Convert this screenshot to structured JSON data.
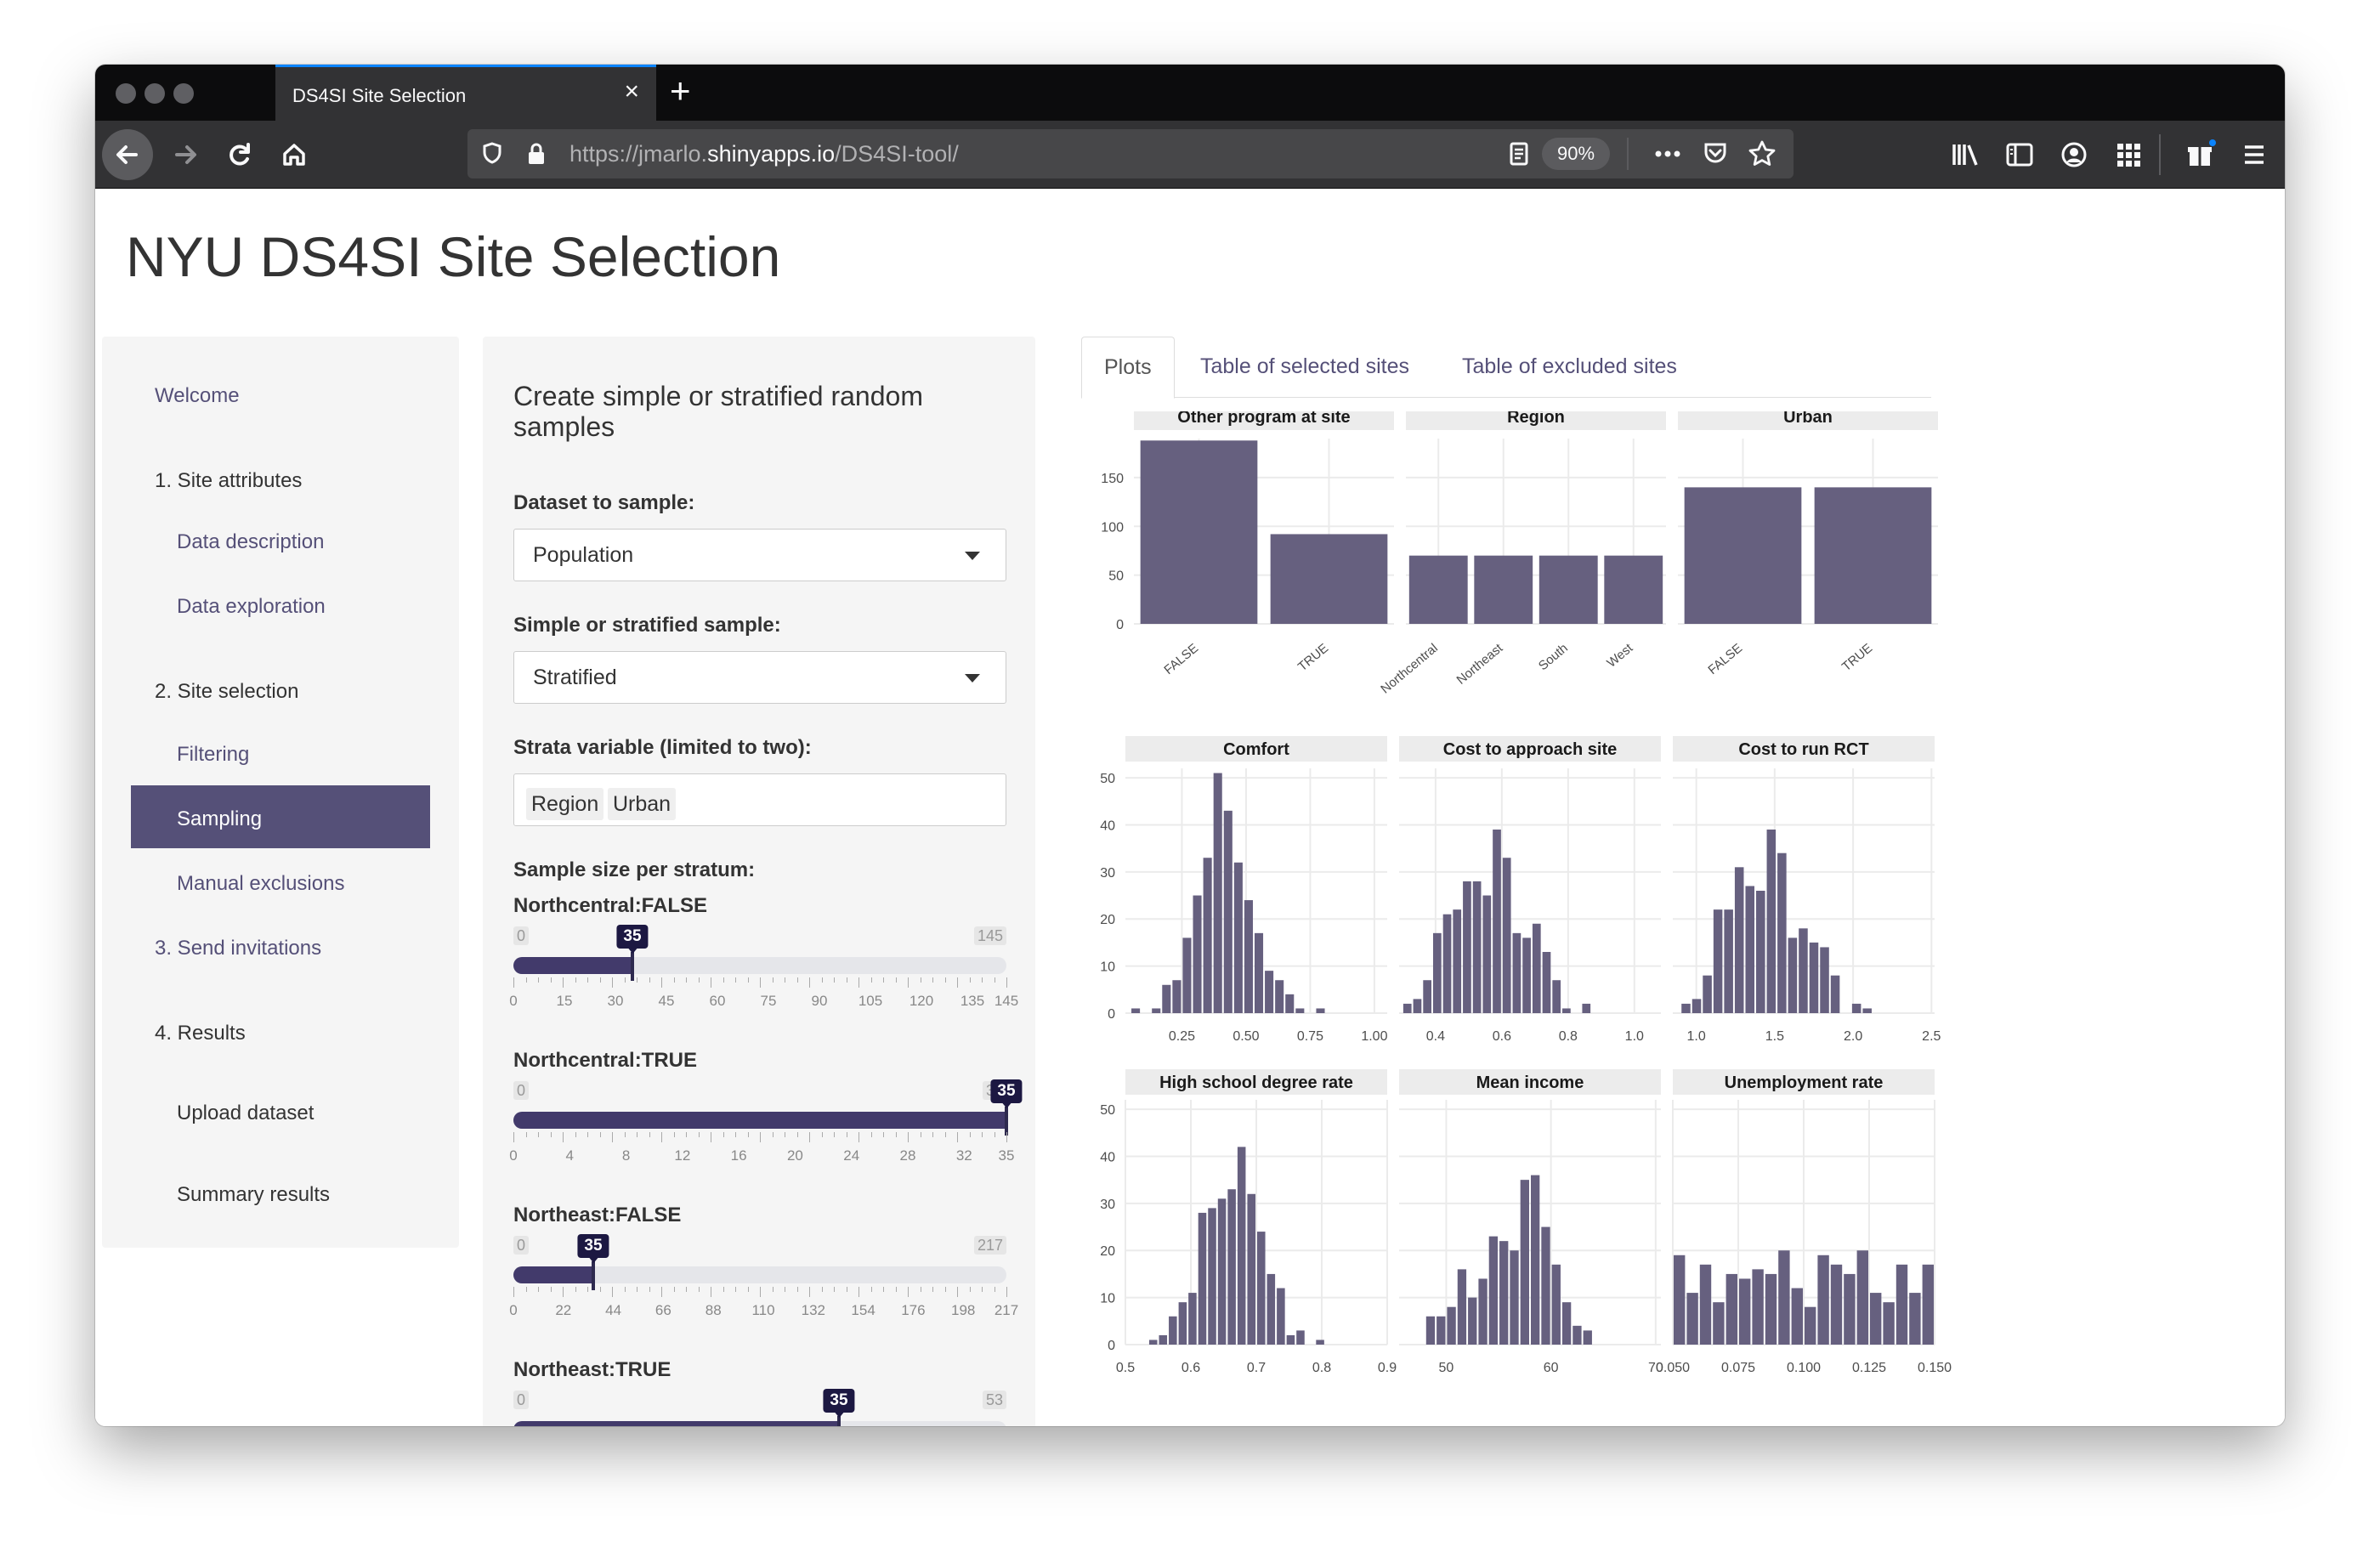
{
  "browser": {
    "tab_title": "DS4SI Site Selection",
    "tab_close": "×",
    "new_tab": "+",
    "url_prefix": "https://jmarlo.",
    "url_domain": "shinyapps.io",
    "url_path": "/DS4SI-tool/",
    "zoom": "90%",
    "icons": [
      "back-arrow-icon",
      "forward-arrow-icon",
      "reload-icon",
      "home-icon",
      "shield-icon",
      "lock-icon",
      "reader-view-icon",
      "more-icon",
      "pocket-icon",
      "star-icon",
      "library-icon",
      "sidebar-icon",
      "account-icon",
      "apps-grid-icon",
      "gift-icon",
      "hamburger-menu-icon"
    ]
  },
  "app": {
    "title": "NYU DS4SI Site Selection"
  },
  "sidebar": {
    "welcome": "Welcome",
    "section1": "1. Site attributes",
    "data_description": "Data description",
    "data_exploration": "Data exploration",
    "section2": "2. Site selection",
    "filtering": "Filtering",
    "sampling": "Sampling",
    "manual_exclusions": "Manual exclusions",
    "section3": "3. Send invitations",
    "section4": "4. Results",
    "upload_dataset": "Upload dataset",
    "summary_results": "Summary results",
    "active_color": "#555078",
    "link_color": "#555078"
  },
  "panel": {
    "heading": "Create simple or stratified random samples",
    "dataset_label": "Dataset to sample:",
    "dataset_value": "Population",
    "type_label": "Simple or stratified sample:",
    "type_value": "Stratified",
    "strata_label": "Strata variable (limited to two):",
    "strata_values": [
      "Region",
      "Urban"
    ],
    "sample_size_label": "Sample size per stratum:",
    "sliders": [
      {
        "label": "Northcentral:FALSE",
        "min": 0,
        "max": 145,
        "value": 35,
        "ticks": [
          0,
          15,
          30,
          45,
          60,
          75,
          90,
          105,
          120,
          135,
          145
        ]
      },
      {
        "label": "Northcentral:TRUE",
        "min": 0,
        "max": 35,
        "value": 35,
        "ticks": [
          0,
          4,
          8,
          12,
          16,
          20,
          24,
          28,
          32,
          35
        ]
      },
      {
        "label": "Northeast:FALSE",
        "min": 0,
        "max": 217,
        "value": 35,
        "ticks": [
          0,
          22,
          44,
          66,
          88,
          110,
          132,
          154,
          176,
          198,
          217
        ]
      },
      {
        "label": "Northeast:TRUE",
        "min": 0,
        "max": 53,
        "value": 35,
        "ticks": []
      }
    ]
  },
  "tabs": [
    "Plots",
    "Table of selected sites",
    "Table of excluded sites"
  ],
  "chart_data": [
    {
      "type": "bar",
      "title": "Other program at site",
      "categories": [
        "FALSE",
        "TRUE"
      ],
      "values": [
        188,
        92
      ],
      "ylim": [
        0,
        190
      ],
      "yticks": [
        0,
        50,
        100,
        150
      ]
    },
    {
      "type": "bar",
      "title": "Region",
      "categories": [
        "Northcentral",
        "Northeast",
        "South",
        "West"
      ],
      "values": [
        70,
        70,
        70,
        70
      ],
      "ylim": [
        0,
        190
      ],
      "yticks": [
        0,
        50,
        100,
        150
      ]
    },
    {
      "type": "bar",
      "title": "Urban",
      "categories": [
        "FALSE",
        "TRUE"
      ],
      "values": [
        140,
        140
      ],
      "ylim": [
        0,
        190
      ],
      "yticks": [
        0,
        50,
        100,
        150
      ]
    },
    {
      "type": "histogram",
      "title": "Comfort",
      "xlim": [
        0.03,
        1.05
      ],
      "ylim": [
        0,
        52
      ],
      "xticks": [
        "0.25",
        "0.50",
        "0.75",
        "1.00"
      ],
      "xtick_values": [
        0.25,
        0.5,
        0.75,
        1.0
      ],
      "yticks": [
        0,
        10,
        20,
        30,
        40,
        50
      ],
      "bin_start": 0.05,
      "bin_width": 0.04,
      "counts": [
        1,
        0,
        1,
        6,
        7,
        16,
        25,
        33,
        51,
        43,
        32,
        24,
        17,
        9,
        7,
        4,
        1,
        0,
        1,
        0
      ]
    },
    {
      "type": "histogram",
      "title": "Cost to approach site",
      "xlim": [
        0.29,
        1.08
      ],
      "ylim": [
        0,
        52
      ],
      "xticks": [
        "0.4",
        "0.6",
        "0.8",
        "1.0"
      ],
      "xtick_values": [
        0.4,
        0.6,
        0.8,
        1.0
      ],
      "yticks": [
        0,
        10,
        20,
        30,
        40,
        50
      ],
      "bin_start": 0.3,
      "bin_width": 0.03,
      "counts": [
        2,
        3,
        7,
        17,
        21,
        22,
        28,
        28,
        25,
        39,
        33,
        17,
        16,
        19,
        13,
        7,
        1,
        0,
        2
      ]
    },
    {
      "type": "histogram",
      "title": "Cost to run RCT",
      "xlim": [
        0.85,
        2.52
      ],
      "ylim": [
        0,
        52
      ],
      "xticks": [
        "1.0",
        "1.5",
        "2.0",
        "2.5"
      ],
      "xtick_values": [
        1.0,
        1.5,
        2.0,
        2.5
      ],
      "yticks": [
        0,
        10,
        20,
        30,
        40,
        50
      ],
      "bin_start": 0.9,
      "bin_width": 0.068,
      "counts": [
        2,
        3,
        8,
        22,
        22,
        31,
        27,
        26,
        39,
        34,
        16,
        18,
        15,
        14,
        8,
        0,
        2,
        1
      ]
    },
    {
      "type": "histogram",
      "title": "High school degree rate",
      "xlim": [
        0.5,
        0.9
      ],
      "ylim": [
        0,
        52
      ],
      "xticks": [
        "0.5",
        "0.6",
        "0.7",
        "0.8",
        "0.9"
      ],
      "xtick_values": [
        0.5,
        0.6,
        0.7,
        0.8,
        0.9
      ],
      "yticks": [
        0,
        10,
        20,
        30,
        40,
        50
      ],
      "bin_start": 0.535,
      "bin_width": 0.015,
      "counts": [
        1,
        2,
        6,
        9,
        11,
        28,
        29,
        31,
        33,
        42,
        32,
        24,
        15,
        12,
        2,
        3,
        0,
        1
      ]
    },
    {
      "type": "histogram",
      "title": "Mean income",
      "xlim": [
        45.5,
        70.5
      ],
      "ylim": [
        0,
        52
      ],
      "xticks": [
        "50",
        "60",
        "70"
      ],
      "xtick_values": [
        50,
        60,
        70
      ],
      "yticks": [
        0,
        10,
        20,
        30,
        40,
        50
      ],
      "bin_start": 48,
      "bin_width": 1,
      "counts": [
        6,
        6,
        8,
        16,
        10,
        14,
        23,
        22,
        20,
        35,
        36,
        25,
        17,
        9,
        4,
        3
      ]
    },
    {
      "type": "histogram",
      "title": "Unemployment rate",
      "xlim": [
        0.05,
        0.15
      ],
      "ylim": [
        0,
        52
      ],
      "xticks": [
        "0.050",
        "0.075",
        "0.100",
        "0.125",
        "0.150"
      ],
      "xtick_values": [
        0.05,
        0.075,
        0.1,
        0.125,
        0.15
      ],
      "yticks": [
        0,
        10,
        20,
        30,
        40,
        50
      ],
      "bin_start": 0.05,
      "bin_width": 0.005,
      "counts": [
        19,
        11,
        17,
        9,
        15,
        14,
        16,
        15,
        20,
        12,
        8,
        19,
        17,
        15,
        20,
        11,
        9,
        17,
        11,
        17
      ]
    }
  ]
}
